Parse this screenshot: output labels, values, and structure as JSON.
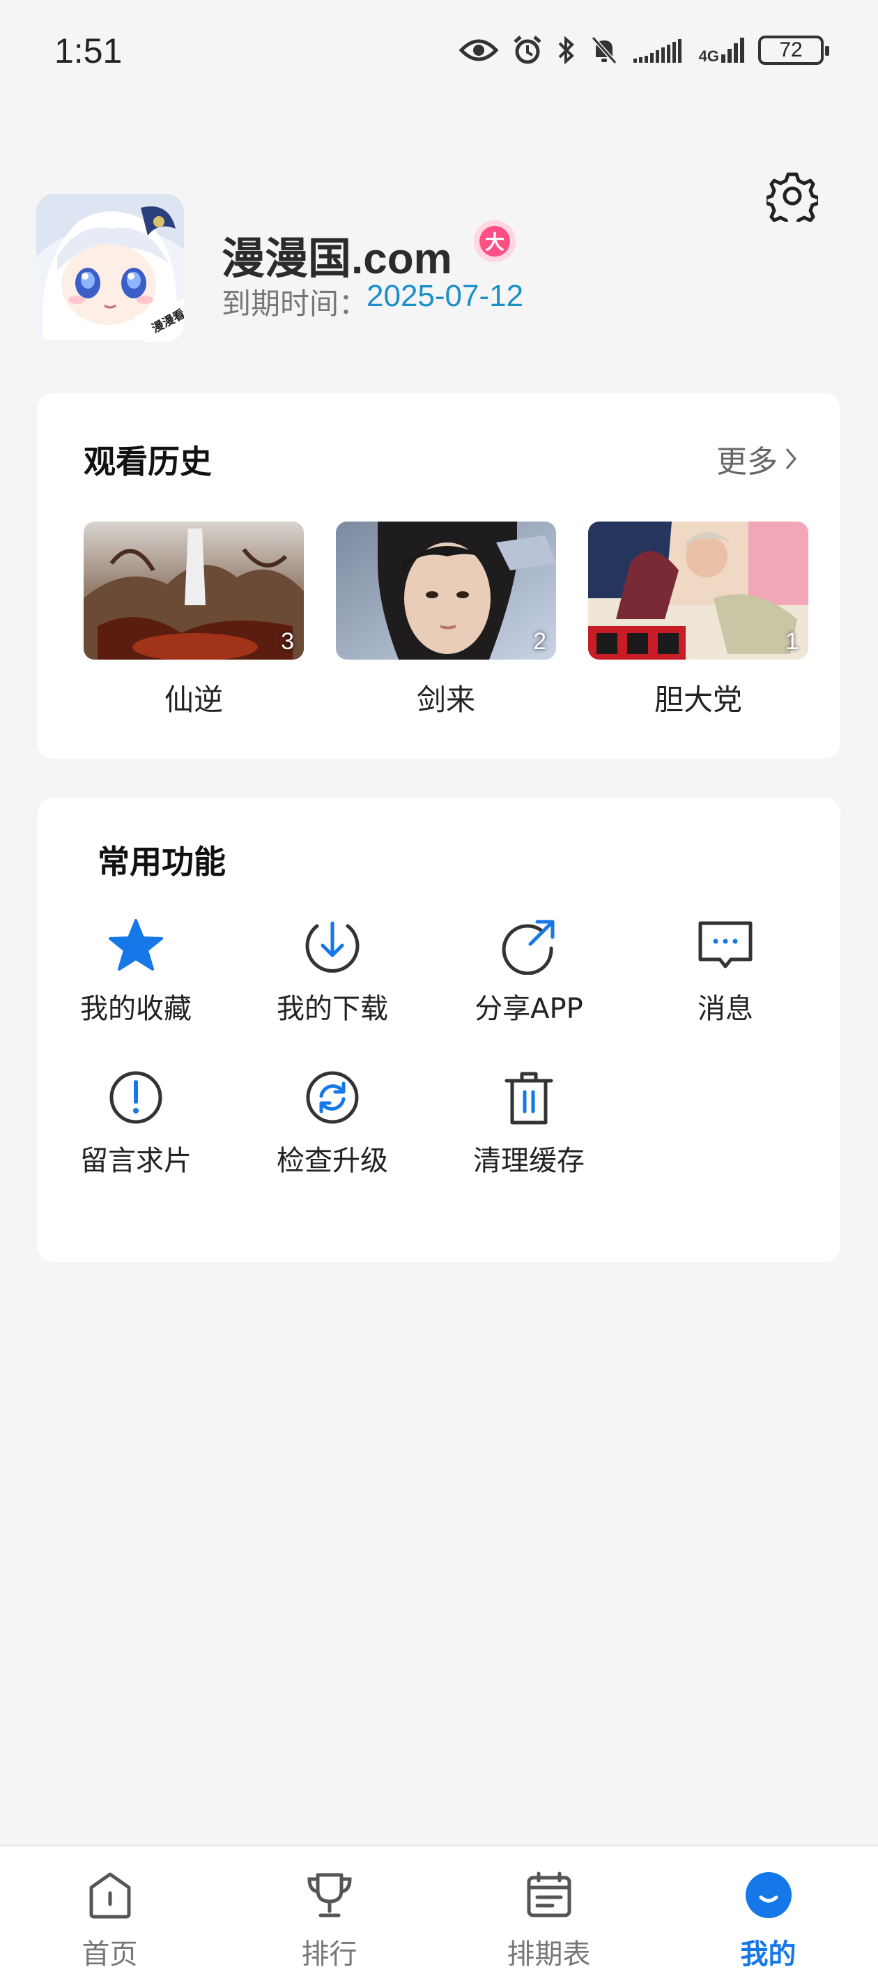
{
  "status_bar": {
    "time": "1:51",
    "battery": "72",
    "network": "4G",
    "icons": [
      "eye-icon",
      "alarm-icon",
      "bluetooth-icon",
      "mute-bell-icon",
      "signal-icon",
      "battery-icon"
    ]
  },
  "profile": {
    "name": "漫漫国.com",
    "badge": "大",
    "expire_label": "到期时间：",
    "expire_date": "2025-07-12",
    "avatar_text": "漫漫看"
  },
  "history": {
    "title": "观看历史",
    "more_label": "更多",
    "items": [
      {
        "title": "仙逆",
        "episode": "3"
      },
      {
        "title": "剑来",
        "episode": "2"
      },
      {
        "title": "胆大党",
        "episode": "1"
      }
    ]
  },
  "functions": {
    "title": "常用功能",
    "items": [
      {
        "label": "我的收藏",
        "icon": "star-icon"
      },
      {
        "label": "我的下载",
        "icon": "download-icon"
      },
      {
        "label": "分享APP",
        "icon": "share-icon"
      },
      {
        "label": "消息",
        "icon": "message-icon"
      },
      {
        "label": "留言求片",
        "icon": "exclamation-icon"
      },
      {
        "label": "检查升级",
        "icon": "refresh-icon"
      },
      {
        "label": "清理缓存",
        "icon": "trash-icon"
      }
    ]
  },
  "nav": {
    "items": [
      {
        "label": "首页",
        "icon": "home-icon"
      },
      {
        "label": "排行",
        "icon": "trophy-icon"
      },
      {
        "label": "排期表",
        "icon": "calendar-icon"
      },
      {
        "label": "我的",
        "icon": "profile-smile-icon"
      }
    ],
    "active_index": 3
  },
  "colors": {
    "accent": "#1577e8",
    "date": "#1a8fc9",
    "badge": "#ff4f85",
    "background": "#f5f5f5"
  }
}
